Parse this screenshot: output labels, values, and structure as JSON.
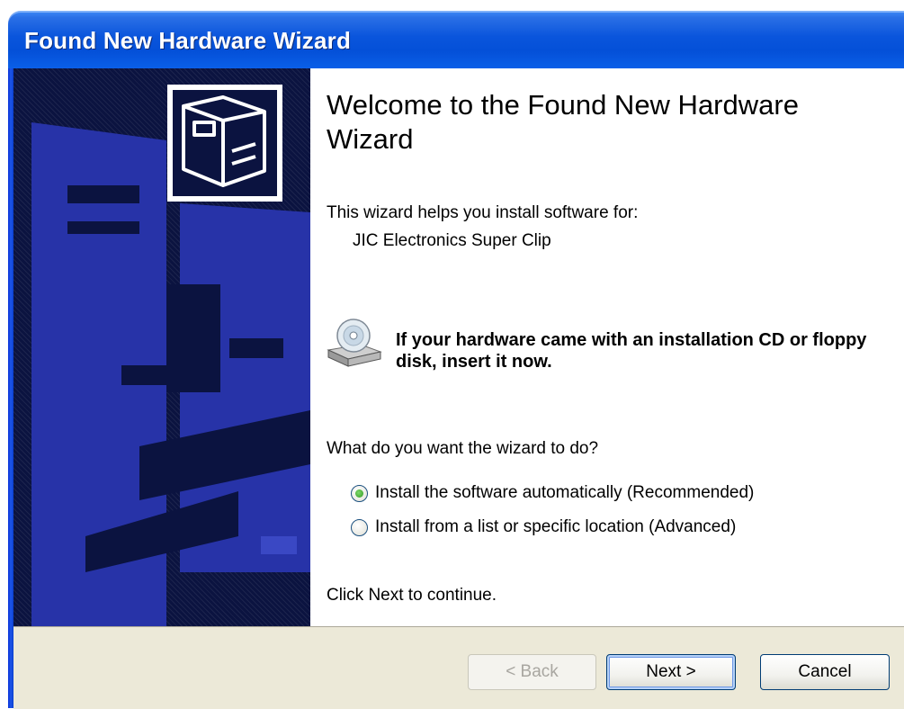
{
  "window": {
    "title": "Found New Hardware Wizard"
  },
  "icons": {
    "hardware": "hardware-icon",
    "cd_drive": "cd-drive-icon"
  },
  "content": {
    "heading": "Welcome to the Found New Hardware Wizard",
    "intro": "This wizard helps you install software for:",
    "device_name": "JIC Electronics Super Clip",
    "cd_message": "If your hardware came with an installation CD or floppy disk, insert it now.",
    "question": "What do you want the wizard to do?",
    "options": [
      {
        "label": "Install the software automatically (Recommended)",
        "checked": true
      },
      {
        "label": "Install from a list or specific location (Advanced)",
        "checked": false
      }
    ],
    "hint": "Click Next to continue."
  },
  "buttons": {
    "back": "< Back",
    "next": "Next >",
    "cancel": "Cancel"
  },
  "colors": {
    "titlebar": "#0450d8",
    "art_panel": "#0b1340",
    "art_shapes": "#2733a8",
    "button_bar": "#ece9d8"
  }
}
